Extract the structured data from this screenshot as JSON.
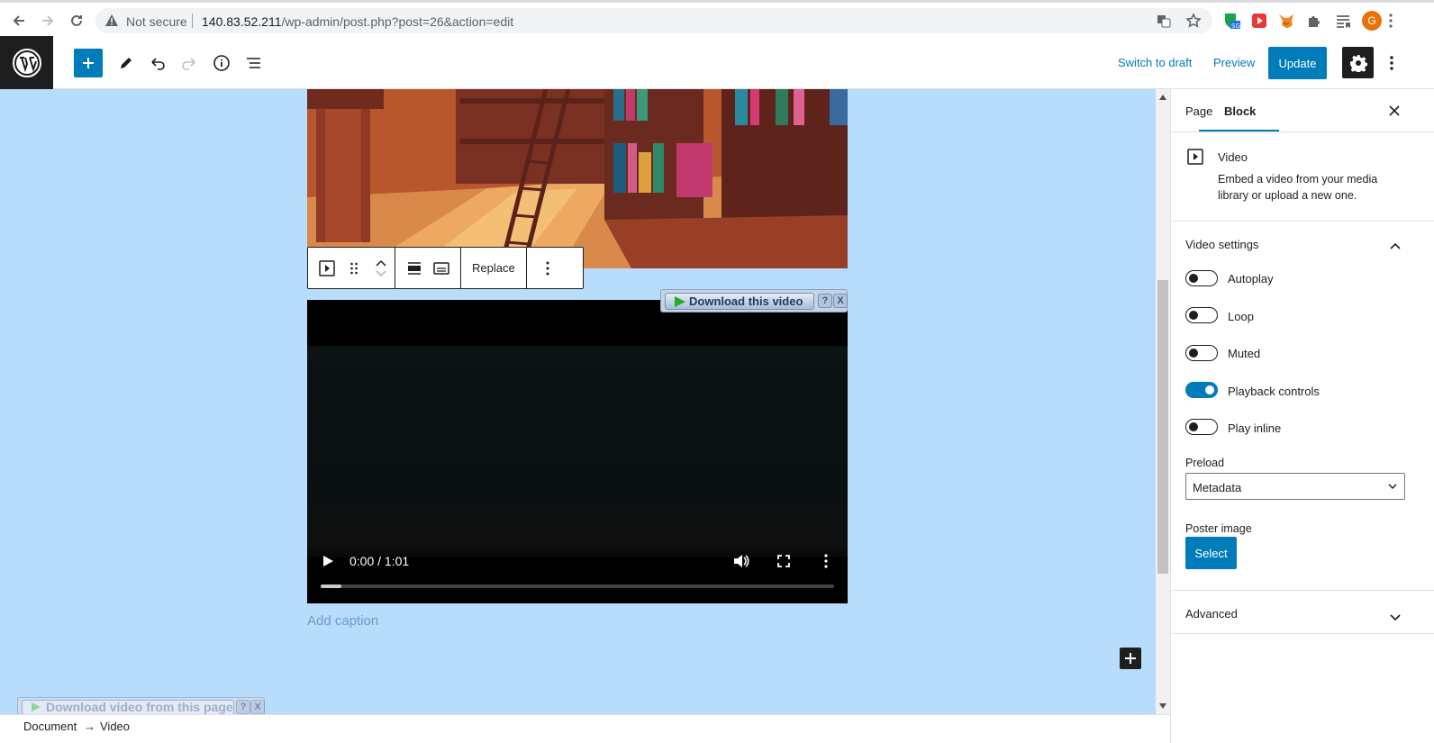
{
  "browser": {
    "security_label": "Not secure",
    "url_host": "140.83.52.211",
    "url_path": "/wp-admin/post.php?post=26&action=edit",
    "profile_initial": "G",
    "ext_badge": "SG"
  },
  "toolbar": {
    "switch_to_draft": "Switch to draft",
    "preview": "Preview",
    "update": "Update"
  },
  "block_toolbar": {
    "replace": "Replace"
  },
  "video": {
    "time": "0:00 / 1:01",
    "progress": 0.04,
    "download_this_video": "Download this video",
    "download_from_page": "Download video from this page",
    "help": "?",
    "close": "X"
  },
  "caption_placeholder": "Add caption",
  "breadcrumb": {
    "root": "Document",
    "arrow": "→",
    "current": "Video"
  },
  "sidebar": {
    "tabs": [
      "Page",
      "Block"
    ],
    "active_tab": "Block",
    "block_name": "Video",
    "block_description": "Embed a video from your media library or upload a new one.",
    "settings_title": "Video settings",
    "toggles": [
      {
        "label": "Autoplay",
        "on": false
      },
      {
        "label": "Loop",
        "on": false
      },
      {
        "label": "Muted",
        "on": false
      },
      {
        "label": "Playback controls",
        "on": true
      },
      {
        "label": "Play inline",
        "on": false
      }
    ],
    "preload_label": "Preload",
    "preload_value": "Metadata",
    "poster_label": "Poster image",
    "select_label": "Select",
    "advanced": "Advanced"
  },
  "colors": {
    "accent": "#007cba",
    "canvas": "#b8dcfb",
    "dark": "#1e1e1e"
  }
}
